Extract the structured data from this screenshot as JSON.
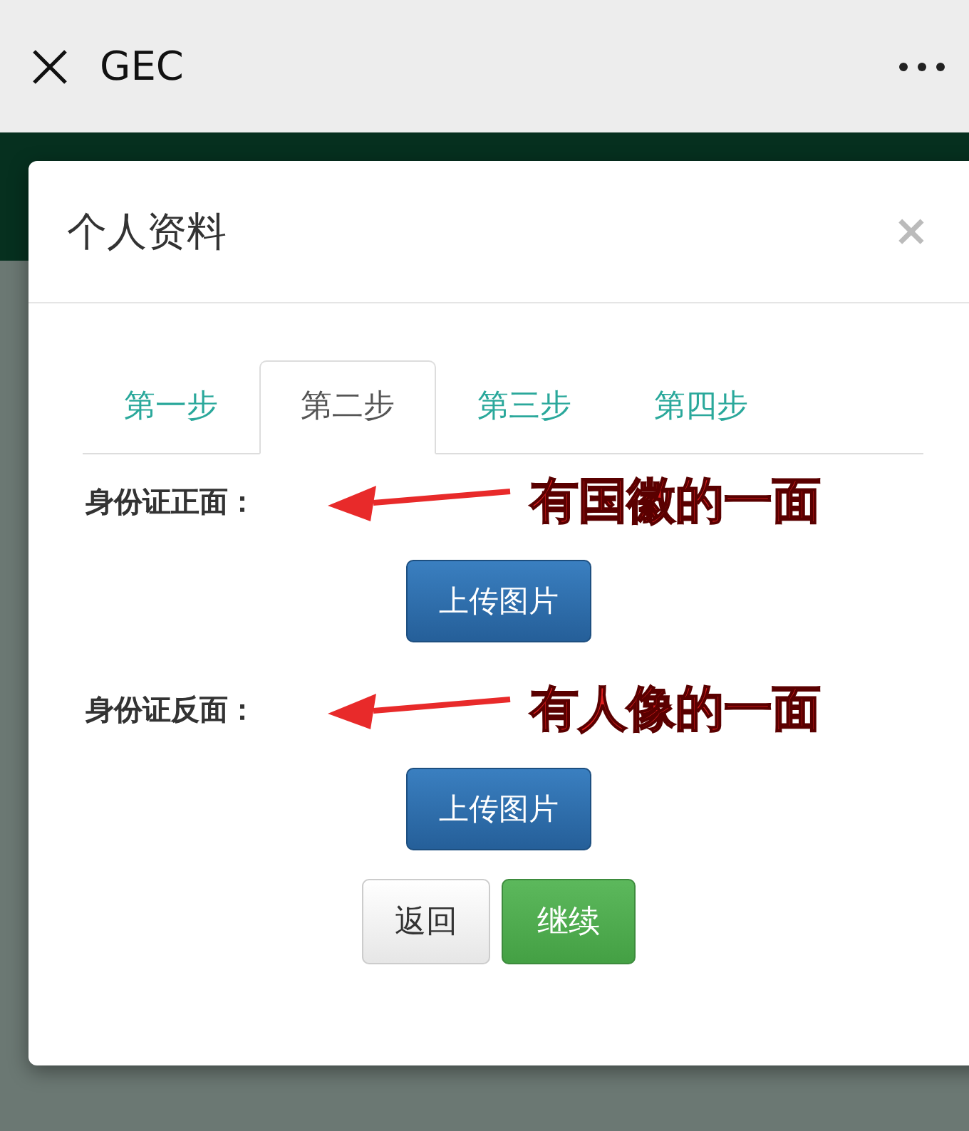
{
  "app_bar": {
    "title": "GEC"
  },
  "dialog": {
    "title": "个人资料",
    "close": "×",
    "tabs": [
      {
        "label": "第一步",
        "selected": false
      },
      {
        "label": "第二步",
        "selected": true
      },
      {
        "label": "第三步",
        "selected": false
      },
      {
        "label": "第四步",
        "selected": false
      }
    ],
    "fields": [
      {
        "label": "身份证正面：",
        "annotation": "有国徽的一面",
        "button": "上传图片"
      },
      {
        "label": "身份证反面：",
        "annotation": "有人像的一面",
        "button": "上传图片"
      }
    ],
    "buttons": [
      {
        "label": "返回",
        "kind": "default"
      },
      {
        "label": "继续",
        "kind": "success"
      }
    ]
  }
}
